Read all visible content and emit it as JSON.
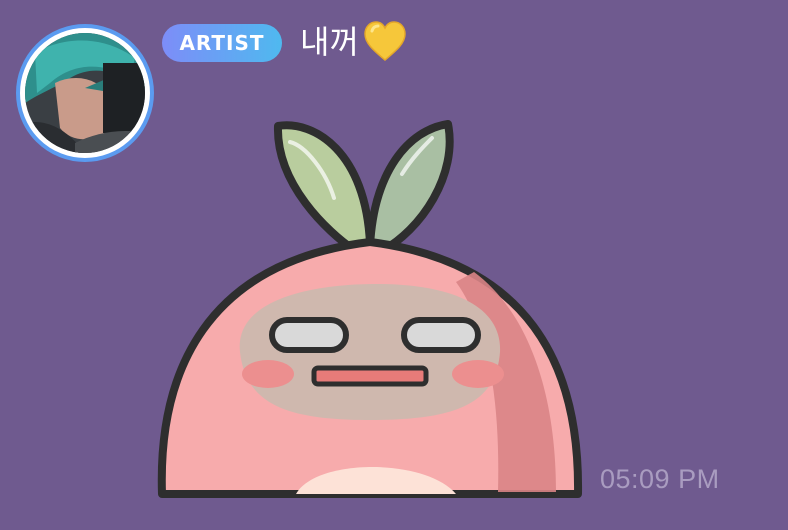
{
  "chat": {
    "sender_role_badge": "ARTIST",
    "message_text": "내꺼",
    "message_emoji_icon": "yellow-heart-icon",
    "sticker_icon": "peach-sticker-icon",
    "timestamp": "05:09 PM"
  },
  "colors": {
    "background": "#6f5a8f",
    "avatar_ring": "#5b9bf0",
    "badge_gradient_start": "#7d8df8",
    "badge_gradient_end": "#4fb9ef",
    "timestamp_text": "#a99cc0",
    "heart": "#f6c73a"
  }
}
